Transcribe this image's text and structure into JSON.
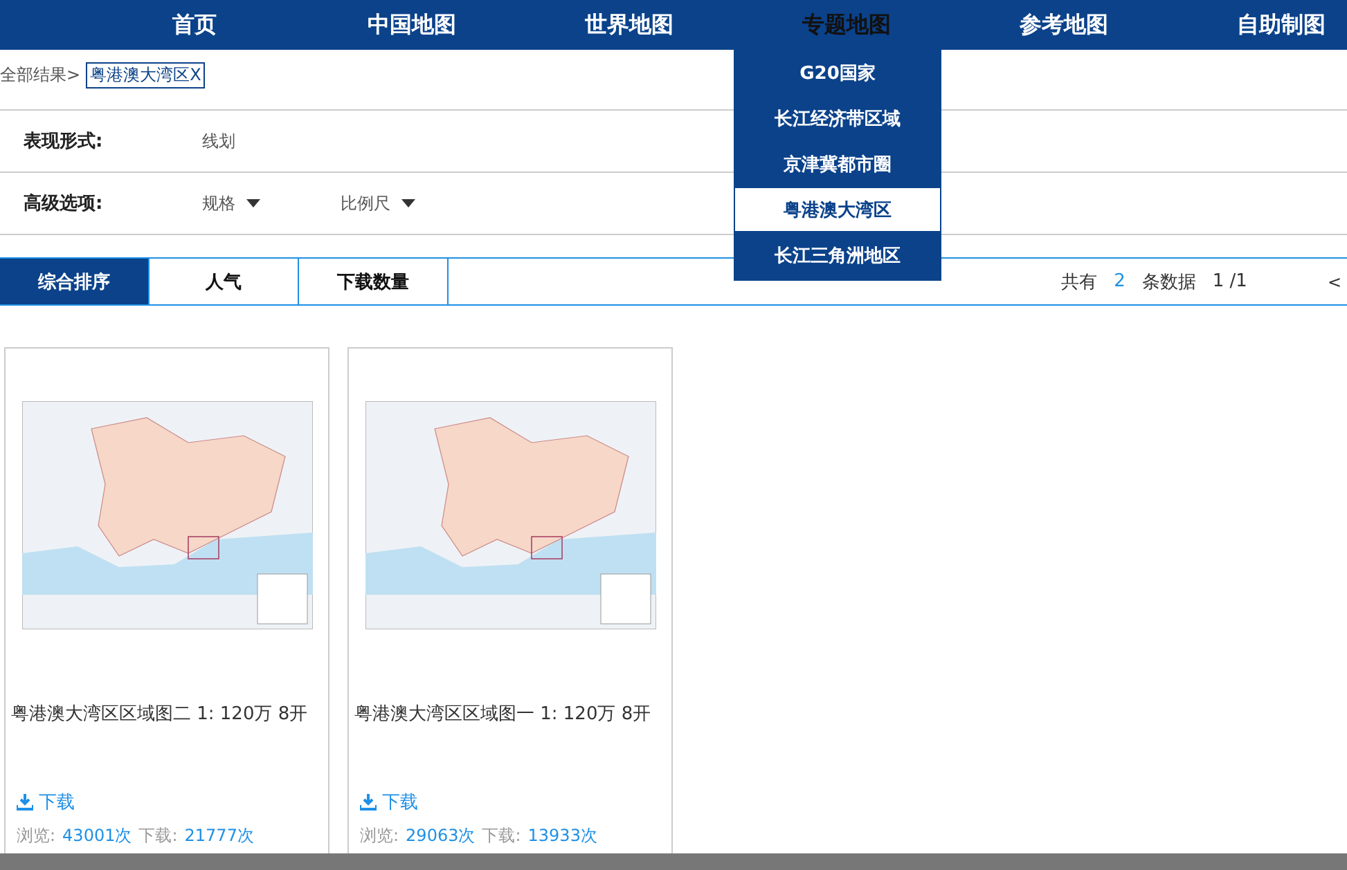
{
  "nav": [
    {
      "label": "首页",
      "selected": false
    },
    {
      "label": "中国地图",
      "selected": false
    },
    {
      "label": "世界地图",
      "selected": false
    },
    {
      "label": "专题地图",
      "selected": true
    },
    {
      "label": "参考地图",
      "selected": false
    },
    {
      "label": "自助制图",
      "selected": false
    }
  ],
  "dropdown": [
    {
      "label": "G20国家",
      "selected": false
    },
    {
      "label": "长江经济带区域",
      "selected": false
    },
    {
      "label": "京津冀都市圈",
      "selected": false
    },
    {
      "label": "粤港澳大湾区",
      "selected": true
    },
    {
      "label": "长江三角洲地区",
      "selected": false
    }
  ],
  "breadcrumb": {
    "root": "全部结果>",
    "tag": "粤港澳大湾区X"
  },
  "filters": [
    {
      "label": "表现形式:",
      "options": [
        {
          "label": "线划",
          "dropdown": false
        }
      ]
    },
    {
      "label": "高级选项:",
      "options": [
        {
          "label": "规格",
          "dropdown": true
        },
        {
          "label": "比例尺",
          "dropdown": true
        }
      ]
    }
  ],
  "sort_tabs": [
    {
      "label": "综合排序",
      "selected": true
    },
    {
      "label": "人气",
      "selected": false
    },
    {
      "label": "下载数量",
      "selected": false
    }
  ],
  "pager": {
    "prefix": "共有",
    "count": "2",
    "suffix": "条数据",
    "page": "1 /1",
    "prev": "<"
  },
  "cards": [
    {
      "title": "粤港澳大湾区区域图二 1: 120万 8开",
      "download": "下载",
      "views_label": "浏览:",
      "views": "43001次",
      "downloads_label": "下载:",
      "downloads": "21777次"
    },
    {
      "title": "粤港澳大湾区区域图一 1: 120万 8开",
      "download": "下载",
      "views_label": "浏览:",
      "views": "29063次",
      "downloads_label": "下载:",
      "downloads": "13933次"
    }
  ]
}
